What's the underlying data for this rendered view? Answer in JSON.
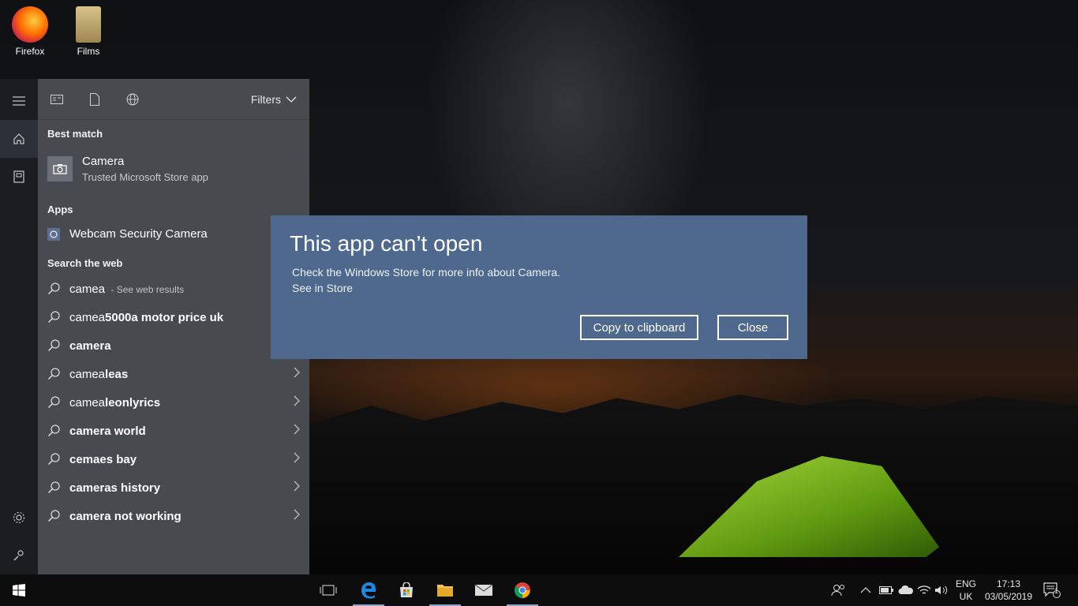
{
  "desktop": {
    "icons": [
      {
        "label": "Firefox",
        "icon": "firefox-icon"
      },
      {
        "label": "Films",
        "icon": "folder-icon"
      }
    ]
  },
  "search_panel": {
    "filters_label": "Filters",
    "best_match_header": "Best match",
    "best_match": {
      "title": "Camera",
      "subtitle": "Trusted Microsoft Store app",
      "icon": "camera-icon"
    },
    "apps_header": "Apps",
    "apps": [
      {
        "label": "Webcam Security Camera",
        "icon": "webcam-icon"
      }
    ],
    "web_header": "Search the web",
    "web_results": [
      {
        "prefix": "camea",
        "bold": "",
        "hint": " - See web results",
        "arrow": false
      },
      {
        "prefix": "camea",
        "bold": "5000a motor price uk",
        "hint": "",
        "arrow": false
      },
      {
        "prefix": "",
        "bold": "camera",
        "hint": "",
        "arrow": false
      },
      {
        "prefix": "camea",
        "bold": "leas",
        "hint": "",
        "arrow": true
      },
      {
        "prefix": "camea",
        "bold": "leonlyrics",
        "hint": "",
        "arrow": true
      },
      {
        "prefix": "",
        "bold": "camera world",
        "hint": "",
        "arrow": true
      },
      {
        "prefix": "",
        "bold": "cemaes bay",
        "hint": "",
        "arrow": true
      },
      {
        "prefix": "",
        "bold": "cameras history",
        "hint": "",
        "arrow": true
      },
      {
        "prefix": "",
        "bold": "camera not working",
        "hint": "",
        "arrow": true
      }
    ],
    "search_value": "camea"
  },
  "dialog": {
    "title": "This app can’t open",
    "message": "Check the Windows Store for more info about Camera.",
    "link": "See in Store",
    "copy_label": "Copy to clipboard",
    "close_label": "Close"
  },
  "taskbar": {
    "lang_line1": "ENG",
    "lang_line2": "UK",
    "time": "17:13",
    "date": "03/05/2019",
    "notification_count": "1"
  },
  "colors": {
    "dialog_bg": "#4e698d",
    "panel_bg": "#474a4f",
    "taskbar_bg": "#0d0d0d"
  }
}
